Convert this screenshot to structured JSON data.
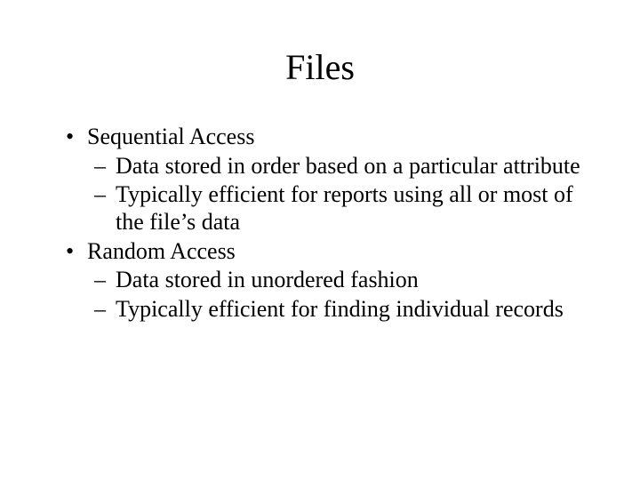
{
  "title": "Files",
  "bullets": {
    "b0": "Sequential Access",
    "b0s0": "Data stored in order based on a particular attribute",
    "b0s1": "Typically efficient for reports using all or most of the file’s data",
    "b1": "Random Access",
    "b1s0": "Data stored in unordered fashion",
    "b1s1": "Typically efficient for finding individual records"
  }
}
